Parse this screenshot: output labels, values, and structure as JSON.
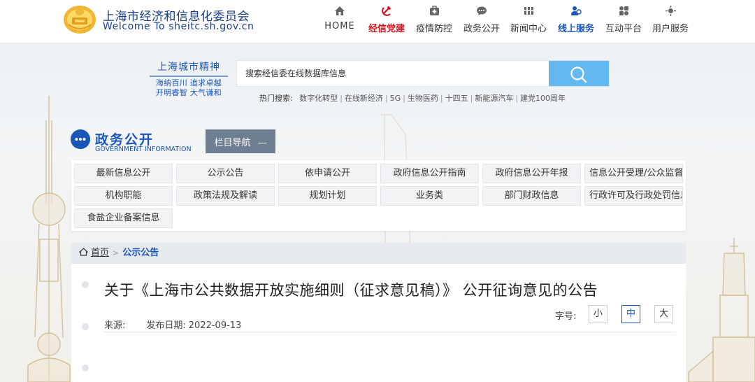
{
  "header": {
    "site_title_cn": "上海市经济和信息化委员会",
    "site_title_en": "Welcome To sheitc.sh.gov.cn",
    "nav": [
      {
        "label": "HOME",
        "icon": "home-icon",
        "state": "normal"
      },
      {
        "label": "经信党建",
        "icon": "hammer-sickle-icon",
        "state": "active-red"
      },
      {
        "label": "疫情防控",
        "icon": "medical-kit-icon",
        "state": "normal"
      },
      {
        "label": "政务公开",
        "icon": "chat-bubble-icon",
        "state": "normal"
      },
      {
        "label": "新闻中心",
        "icon": "news-icon",
        "state": "normal"
      },
      {
        "label": "线上服务",
        "icon": "user-service-icon",
        "state": "active-blue"
      },
      {
        "label": "互动平台",
        "icon": "grid-icon",
        "state": "normal"
      },
      {
        "label": "用户服务",
        "icon": "star-icon",
        "state": "normal"
      }
    ]
  },
  "spirit": {
    "title": "上海城市精神",
    "line1": "海纳百川 追求卓越",
    "line2": "开明睿智 大气谦和"
  },
  "search": {
    "placeholder": "搜索经信委在线数据库信息",
    "hot_label": "热门搜索:",
    "hot_items": [
      "数字化转型",
      "在线新经济",
      "5G",
      "生物医药",
      "十四五",
      "新能源汽车",
      "建党100周年"
    ]
  },
  "section": {
    "title_cn": "政务公开",
    "title_en": "GOVERNMENT INFORMATION",
    "column_nav_label": "栏目导航",
    "column_nav_toggle": "—"
  },
  "categories": {
    "row1": [
      "最新信息公开",
      "公示公告",
      "依申请公开",
      "政府信息公开指南",
      "政府信息公开年报",
      "信息公开受理/公众监督"
    ],
    "row2": [
      "机构职能",
      "政策法规及解读",
      "规划计划",
      "业务类",
      "部门财政信息",
      "行政许可及行政处罚信息"
    ],
    "row3": [
      "食盐企业备案信息"
    ]
  },
  "breadcrumb": {
    "home": "首页",
    "separator": ">",
    "current": "公示公告"
  },
  "article": {
    "title": "关于《上海市公共数据开放实施细则（征求意见稿）》 公开征询意见的公告",
    "source_label": "来源:",
    "source_value": "",
    "date_label": "发布日期:",
    "date_value": "2022-09-13",
    "font_size_label": "字号:",
    "font_sizes": [
      "小",
      "中",
      "大"
    ],
    "active_font_size": "中"
  },
  "colors": {
    "brand_blue": "#1a56b8",
    "party_red": "#d0121b",
    "search_button": "#62b8ef",
    "column_nav_button": "#6e7f92"
  }
}
